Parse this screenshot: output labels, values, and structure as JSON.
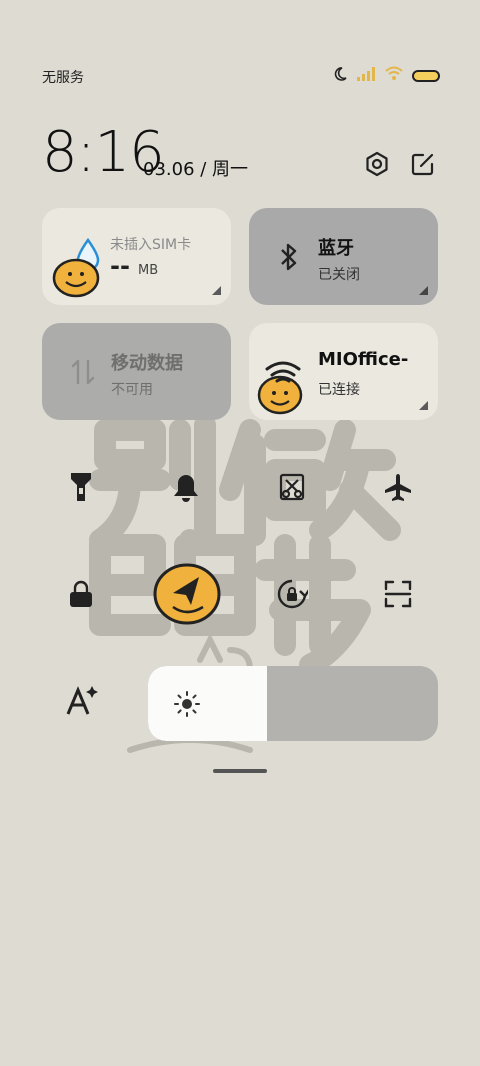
{
  "status_bar": {
    "carrier": "无服务",
    "icons": [
      "moon-icon",
      "signal-icon",
      "wifi-icon",
      "battery-icon"
    ]
  },
  "header": {
    "time": "8:16",
    "date": "03.06 / 周一",
    "icons": [
      "settings-icon",
      "edit-icon"
    ]
  },
  "tiles": {
    "sim": {
      "title": "未插入SIM卡",
      "value": "--",
      "unit": "MB"
    },
    "bluetooth": {
      "title": "蓝牙",
      "status": "已关闭"
    },
    "mobile_data": {
      "title": "移动数据",
      "status": "不可用"
    },
    "wifi": {
      "title": "MIOffice-",
      "status": "已连接"
    }
  },
  "toggles": {
    "row1": [
      "flashlight-icon",
      "bell-icon",
      "screenshot-icon",
      "airplane-icon"
    ],
    "row2": [
      "lock-icon",
      "location-icon",
      "rotation-lock-icon",
      "scanner-icon"
    ]
  },
  "brightness": {
    "level": 0.41,
    "icon": "sun-icon",
    "left_icon": "font-size-icon"
  },
  "colors": {
    "accent": "#f4cf5d",
    "tile_light": "#ebe8df",
    "tile_dark": "#a9a9a9"
  }
}
